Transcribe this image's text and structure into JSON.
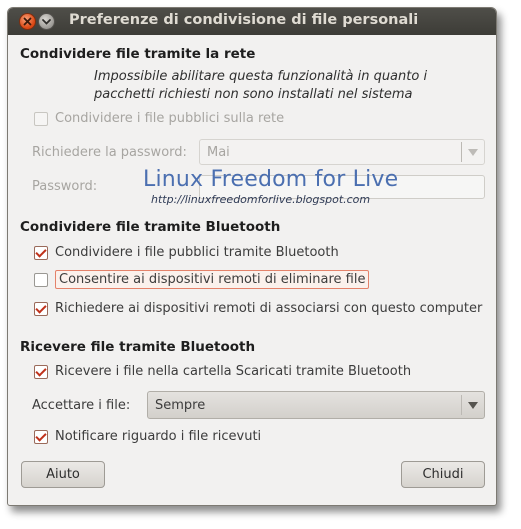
{
  "window": {
    "title": "Preferenze di condivisione di file personali"
  },
  "network_section": {
    "heading": "Condividere file tramite la rete",
    "info": "Impossibile abilitare questa funzionalità in quanto i pacchetti richiesti non sono installati nel sistema",
    "share_public_files": {
      "label": "Condividere i file pubblici sulla rete",
      "checked": false,
      "enabled": false
    },
    "require_password": {
      "label": "Richiedere la password:",
      "value": "Mai",
      "enabled": false
    },
    "password": {
      "label": "Password:",
      "value": "",
      "enabled": false
    }
  },
  "bluetooth_share_section": {
    "heading": "Condividere file tramite Bluetooth",
    "options": [
      {
        "label": "Condividere i file pubblici tramite Bluetooth",
        "checked": true
      },
      {
        "label": "Consentire ai dispositivi remoti di eliminare file",
        "checked": false,
        "focused": true
      },
      {
        "label": "Richiedere ai dispositivi remoti di associarsi con questo computer",
        "checked": true
      }
    ]
  },
  "bluetooth_receive_section": {
    "heading": "Ricevere file tramite Bluetooth",
    "receive_to_downloads": {
      "label": "Ricevere i file nella cartella Scaricati tramite Bluetooth",
      "checked": true
    },
    "accept_files": {
      "label": "Accettare i file:",
      "value": "Sempre"
    },
    "notify_received": {
      "label": "Notificare riguardo i file ricevuti",
      "checked": true
    }
  },
  "buttons": {
    "help": "Aiuto",
    "close": "Chiudi"
  },
  "watermark": {
    "title": "Linux Freedom for Live",
    "url": "http://linuxfreedomforlive.blogspot.com"
  },
  "colors": {
    "titlebar": "#3d3c37",
    "window_bg": "#f2f1f0",
    "check_accent": "#c0321b",
    "close_button": "#dd4814"
  },
  "icons": [
    "close-icon",
    "window-menu-icon",
    "dropdown-arrow-icon",
    "checkmark-icon"
  ]
}
